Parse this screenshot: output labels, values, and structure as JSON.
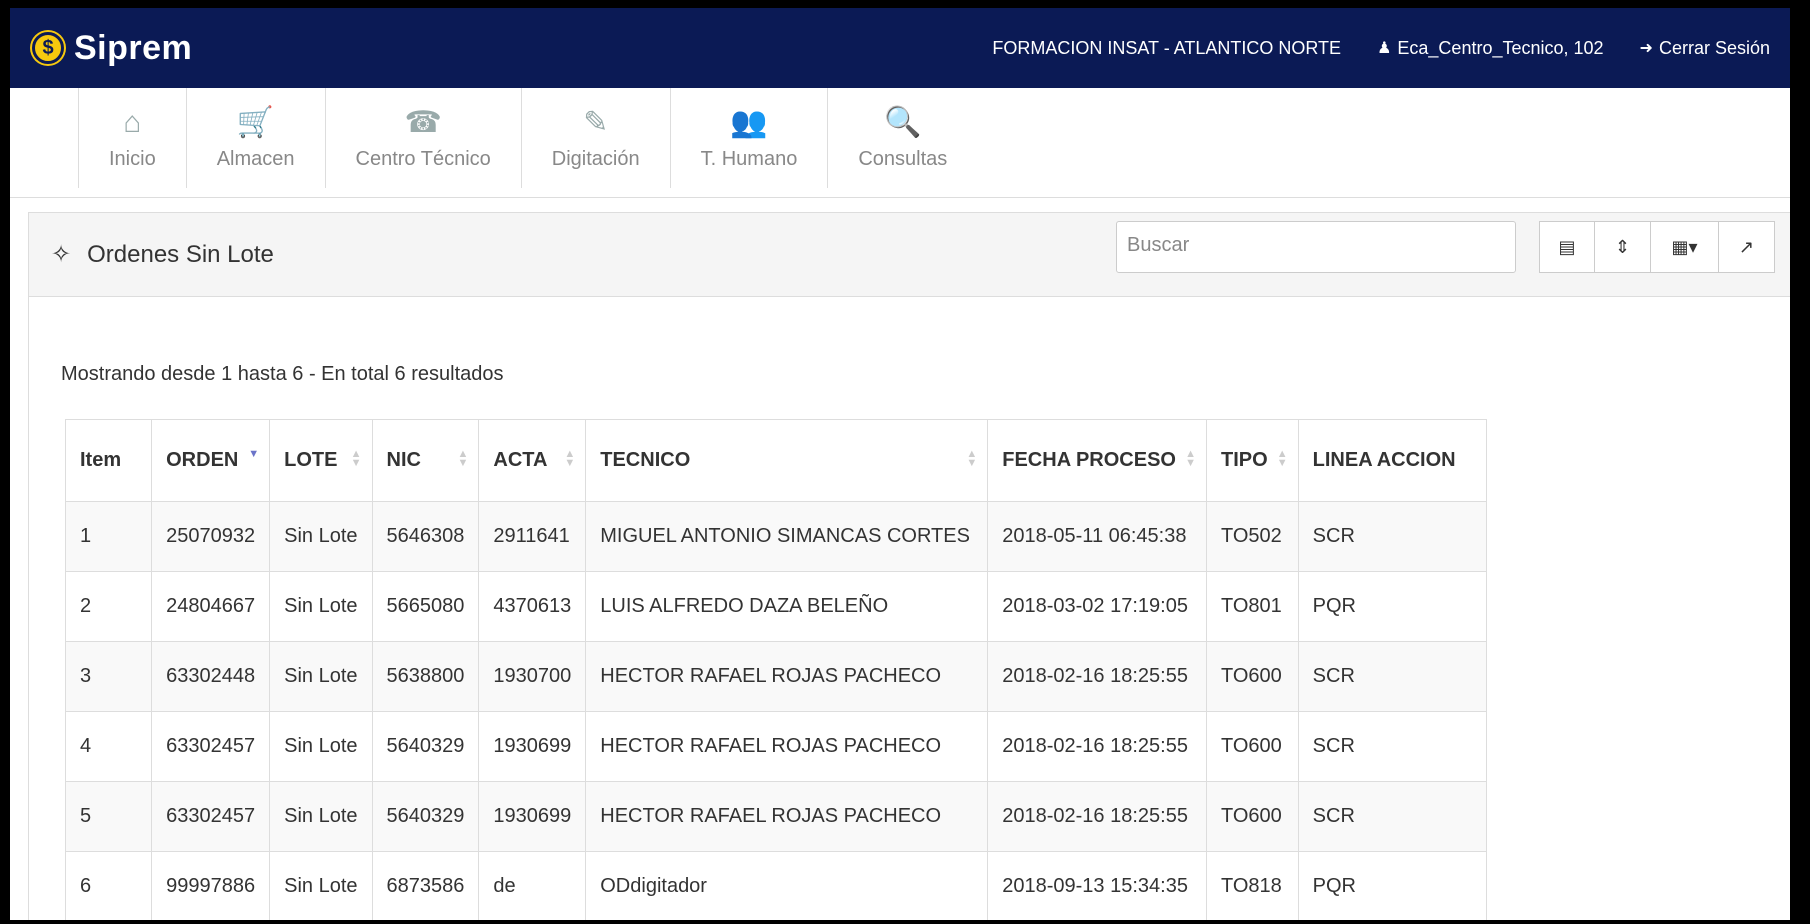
{
  "brand": {
    "logo_glyph": "$",
    "name": "Siprem"
  },
  "topbar": {
    "org": "FORMACION INSAT - ATLANTICO NORTE",
    "user": "Eca_Centro_Tecnico, 102",
    "logout": "Cerrar Sesión"
  },
  "menu": {
    "items": [
      {
        "label": "Inicio",
        "icon": "home-icon",
        "glyph": "⌂"
      },
      {
        "label": "Almacen",
        "icon": "cart-icon",
        "glyph": "🛒"
      },
      {
        "label": "Centro Técnico",
        "icon": "phone-icon",
        "glyph": "☎"
      },
      {
        "label": "Digitación",
        "icon": "pencil-icon",
        "glyph": "✎"
      },
      {
        "label": "T. Humano",
        "icon": "users-icon",
        "glyph": "👥"
      },
      {
        "label": "Consultas",
        "icon": "search-icon",
        "glyph": "🔍"
      }
    ]
  },
  "panel": {
    "title": "Ordenes Sin Lote",
    "search_placeholder": "Buscar",
    "summary": "Mostrando desde 1 hasta 6 - En total 6 resultados"
  },
  "table": {
    "columns": [
      "Item",
      "ORDEN",
      "LOTE",
      "NIC",
      "ACTA",
      "TECNICO",
      "FECHA PROCESO",
      "TIPO",
      "LINEA ACCION"
    ],
    "rows": [
      [
        "1",
        "25070932",
        "Sin Lote",
        "5646308",
        "2911641",
        "MIGUEL ANTONIO SIMANCAS CORTES",
        "2018-05-11 06:45:38",
        "TO502",
        "SCR"
      ],
      [
        "2",
        "24804667",
        "Sin Lote",
        "5665080",
        "4370613",
        "LUIS ALFREDO DAZA BELEÑO",
        "2018-03-02 17:19:05",
        "TO801",
        "PQR"
      ],
      [
        "3",
        "63302448",
        "Sin Lote",
        "5638800",
        "1930700",
        "HECTOR RAFAEL ROJAS PACHECO",
        "2018-02-16 18:25:55",
        "TO600",
        "SCR"
      ],
      [
        "4",
        "63302457",
        "Sin Lote",
        "5640329",
        "1930699",
        "HECTOR RAFAEL ROJAS PACHECO",
        "2018-02-16 18:25:55",
        "TO600",
        "SCR"
      ],
      [
        "5",
        "63302457",
        "Sin Lote",
        "5640329",
        "1930699",
        "HECTOR RAFAEL ROJAS PACHECO",
        "2018-02-16 18:25:55",
        "TO600",
        "SCR"
      ],
      [
        "6",
        "99997886",
        "Sin Lote",
        "6873586",
        "de",
        "ODdigitador",
        "2018-09-13 15:34:35",
        "TO818",
        "PQR"
      ]
    ]
  },
  "colors": {
    "topbar": "#0b1a55",
    "logo": "#f6c90e",
    "sort_active": "#6b74c9"
  }
}
